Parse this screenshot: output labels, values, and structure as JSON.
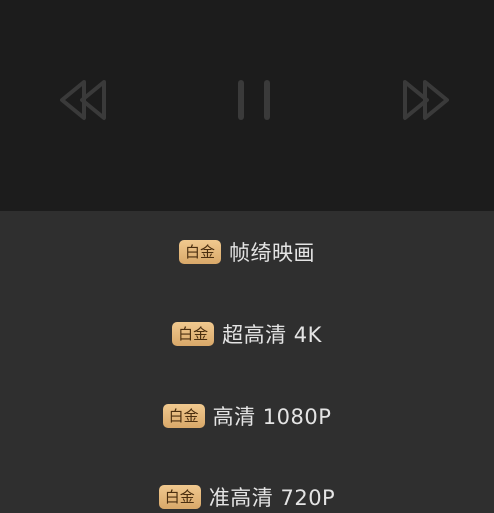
{
  "player": {
    "controls": [
      {
        "name": "rewind-button",
        "icon": "rewind-icon"
      },
      {
        "name": "pause-button",
        "icon": "pause-icon"
      },
      {
        "name": "fast-forward-button",
        "icon": "fast-forward-icon"
      }
    ],
    "icon_color": "#3a3a3a"
  },
  "quality_sheet": {
    "badge_color": "#e6b87b",
    "options": [
      {
        "badge": "白金",
        "label": "帧绮映画"
      },
      {
        "badge": "白金",
        "label": "超高清 4K"
      },
      {
        "badge": "白金",
        "label": "高清 1080P"
      },
      {
        "badge": "白金",
        "label": "准高清 720P"
      }
    ]
  }
}
